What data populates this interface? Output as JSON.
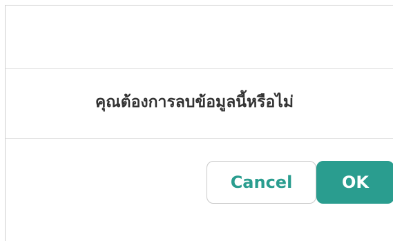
{
  "dialog": {
    "message": "คุณต้องการลบข้อมูลนี้หรือไม่",
    "cancel_label": "Cancel",
    "ok_label": "OK"
  },
  "colors": {
    "accent": "#2a9d8f",
    "text": "#333333",
    "divider": "#e3e3e3"
  }
}
